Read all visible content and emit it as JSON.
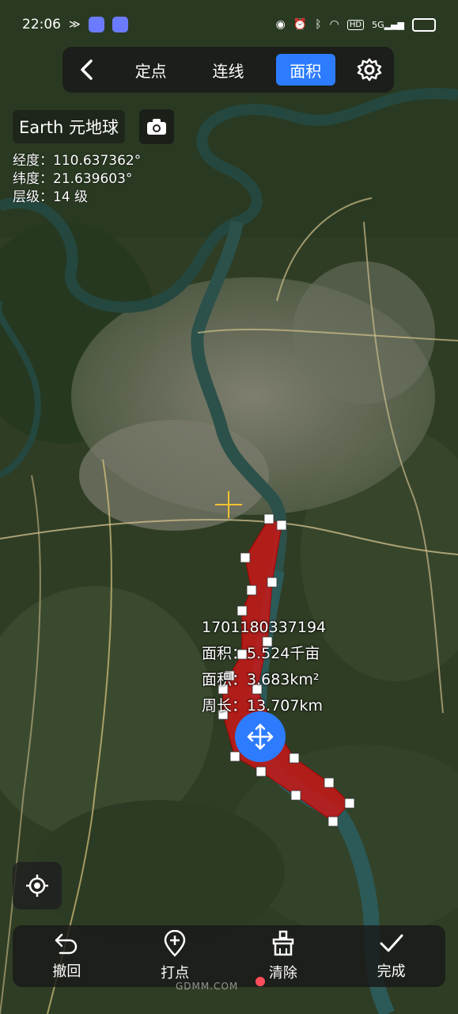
{
  "status_bar": {
    "time": "22:06",
    "network_label": "5G",
    "hd_label": "HD"
  },
  "toolbar": {
    "tabs": [
      {
        "label": "定点"
      },
      {
        "label": "连线"
      },
      {
        "label": "面积"
      }
    ],
    "active_tab": "面积"
  },
  "header": {
    "app_title": "Earth 元地球"
  },
  "coordinates": {
    "longitude": "经度：110.637362°",
    "latitude": "纬度：21.639603°",
    "level": "层级：14 级"
  },
  "measurement": {
    "id": "1701180337194",
    "area_mu": "面积：5.524千亩",
    "area_km": "面积：3.683km²",
    "perimeter": "周长：13.707km"
  },
  "bottom_bar": {
    "undo": "撤回",
    "add_point": "打点",
    "clear": "清除",
    "done": "完成"
  },
  "watermark": {
    "brand": "GDMM.COM"
  },
  "colors": {
    "accent": "#2d7cff",
    "polygon_fill": "#c81818",
    "bar_bg": "#191919"
  }
}
